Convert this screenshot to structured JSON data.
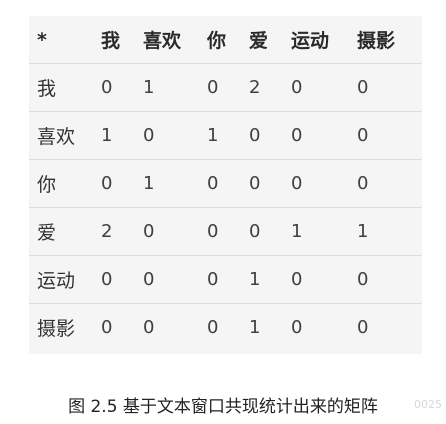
{
  "table": {
    "header": [
      "*",
      "我",
      "喜欢",
      "你",
      "爱",
      "运动",
      "摄影"
    ],
    "rows": [
      {
        "label": "我",
        "values": [
          "0",
          "1",
          "0",
          "2",
          "0",
          "0"
        ]
      },
      {
        "label": "喜欢",
        "values": [
          "1",
          "0",
          "1",
          "0",
          "0",
          "0"
        ]
      },
      {
        "label": "你",
        "values": [
          "0",
          "1",
          "0",
          "0",
          "0",
          "0"
        ]
      },
      {
        "label": "爱",
        "values": [
          "2",
          "0",
          "0",
          "0",
          "1",
          "1"
        ]
      },
      {
        "label": "运动",
        "values": [
          "0",
          "0",
          "0",
          "1",
          "0",
          "0"
        ]
      },
      {
        "label": "摄影",
        "values": [
          "0",
          "0",
          "0",
          "1",
          "0",
          "0"
        ]
      }
    ]
  },
  "caption": "图 2.5  基于文本窗口共现统计出来的矩阵",
  "watermark": "0025"
}
